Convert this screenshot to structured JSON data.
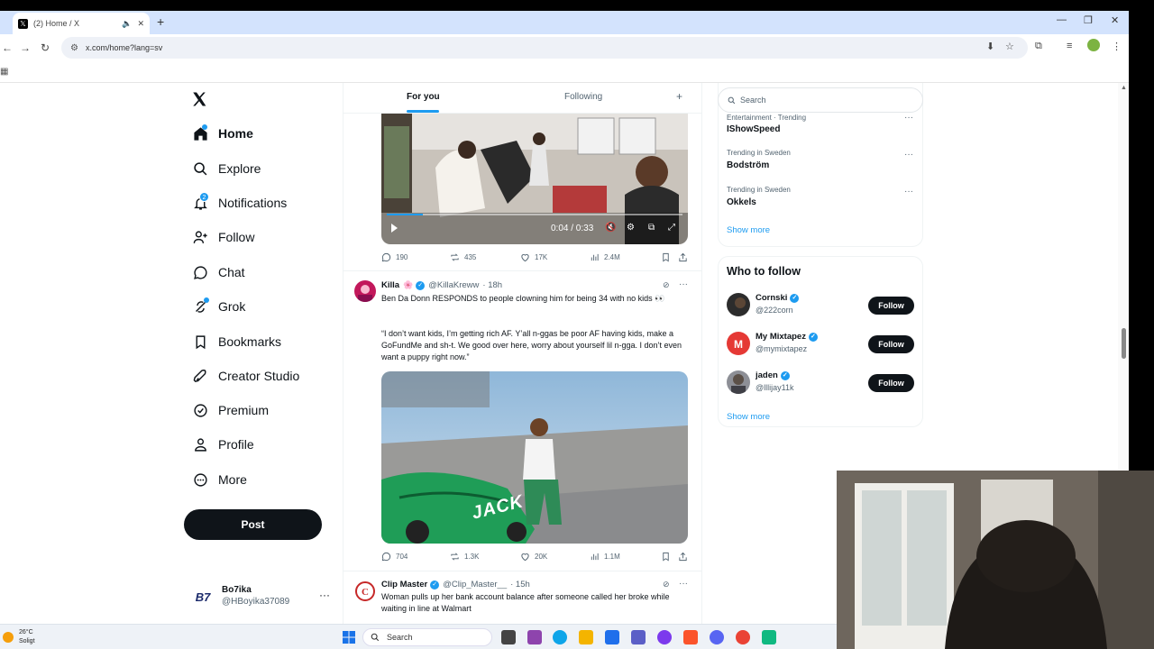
{
  "browser": {
    "tab_title": "(2) Home / X",
    "url": "x.com/home?lang=sv"
  },
  "nav": {
    "items": [
      {
        "label": "Home",
        "icon": "home-icon"
      },
      {
        "label": "Explore",
        "icon": "search-icon"
      },
      {
        "label": "Notifications",
        "icon": "bell-icon",
        "badge": "2"
      },
      {
        "label": "Follow",
        "icon": "person-plus-icon"
      },
      {
        "label": "Chat",
        "icon": "chat-bubble-icon"
      },
      {
        "label": "Grok",
        "icon": "grok-icon"
      },
      {
        "label": "Bookmarks",
        "icon": "bookmark-icon"
      },
      {
        "label": "Creator Studio",
        "icon": "rocket-icon"
      },
      {
        "label": "Premium",
        "icon": "verified-badge-icon"
      },
      {
        "label": "Profile",
        "icon": "person-icon"
      },
      {
        "label": "More",
        "icon": "more-circle-icon"
      }
    ],
    "post_label": "Post",
    "account": {
      "avatar": "B7",
      "name": "Bo7ika",
      "handle": "@HBoyika37089"
    }
  },
  "timeline": {
    "tabs": {
      "for_you": "For you",
      "following": "Following",
      "plus": "+"
    },
    "tweet1": {
      "video_time": "0:04 / 0:33",
      "replies": "190",
      "reposts": "435",
      "likes": "17K",
      "views": "2.4M"
    },
    "tweet2": {
      "name": "Killa",
      "handle": "@KillaKreww",
      "time": "· 18h",
      "text1": "Ben Da Donn RESPONDS to people clowning him for being 34 with no kids 👀",
      "text2": "“I don’t want kids, I’m getting rich AF. Y’all n-ggas be poor AF having kids, make a GoFundMe and sh-t. We good over here, worry about yourself lil n-gga. I don’t even want a puppy right now.”",
      "replies": "704",
      "reposts": "1.3K",
      "likes": "20K",
      "views": "1.1M",
      "overlay_text": "JACK"
    },
    "tweet3": {
      "name": "Clip Master",
      "handle": "@Clip_Master__",
      "time": "· 15h",
      "text": "Woman pulls up her bank account balance after someone called her broke while waiting in line at Walmart"
    }
  },
  "sidebar": {
    "search_placeholder": "Search",
    "trends": [
      {
        "category": "Entertainment · Trending",
        "name": "IShowSpeed"
      },
      {
        "category": "Trending in Sweden",
        "name": "Bodström"
      },
      {
        "category": "Trending in Sweden",
        "name": "Okkels"
      }
    ],
    "show_more": "Show more",
    "who_to_follow": {
      "title": "Who to follow",
      "follow_label": "Follow",
      "accounts": [
        {
          "name": "Cornski",
          "handle": "@222corn"
        },
        {
          "name": "My Mixtapez",
          "handle": "@mymixtapez"
        },
        {
          "name": "jaden",
          "handle": "@lllijay11k"
        }
      ],
      "show_more": "Show more"
    }
  },
  "taskbar": {
    "weather_temp": "26°C",
    "weather_desc": "Soligt",
    "search_label": "Search"
  },
  "colors": {
    "accent": "#1d9bf0",
    "text": "#0f1419",
    "muted": "#536471"
  }
}
